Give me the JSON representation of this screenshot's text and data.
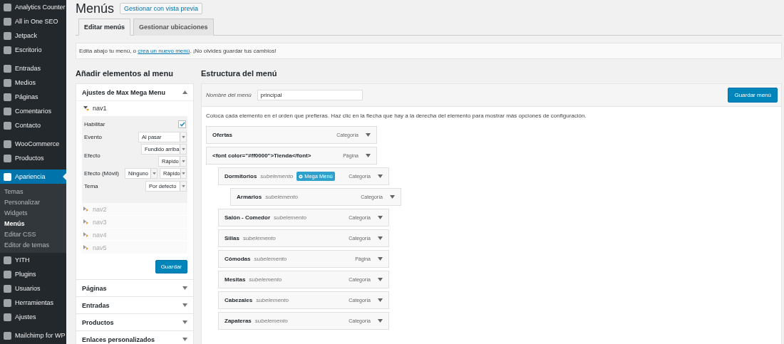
{
  "sidebar": {
    "groups": [
      [
        {
          "label": "Analytics Counter",
          "selected": false
        },
        {
          "label": "All in One SEO",
          "selected": false
        },
        {
          "label": "Jetpack",
          "selected": false
        },
        {
          "label": "Escritorio",
          "selected": false
        }
      ],
      [
        {
          "label": "Entradas",
          "selected": false
        },
        {
          "label": "Medios",
          "selected": false
        },
        {
          "label": "Páginas",
          "selected": false
        },
        {
          "label": "Comentarios",
          "selected": false
        },
        {
          "label": "Contacto",
          "selected": false
        }
      ],
      [
        {
          "label": "WooCommerce",
          "selected": false
        },
        {
          "label": "Productos",
          "selected": false
        }
      ],
      [
        {
          "label": "Apariencia",
          "selected": true,
          "children": [
            {
              "label": "Temas",
              "selected": false
            },
            {
              "label": "Personalizar",
              "selected": false
            },
            {
              "label": "Widgets",
              "selected": false
            },
            {
              "label": "Menús",
              "selected": true
            },
            {
              "label": "Editar CSS",
              "selected": false
            },
            {
              "label": "Editor de temas",
              "selected": false
            }
          ]
        },
        {
          "label": "YITH",
          "selected": false
        },
        {
          "label": "Plugins",
          "selected": false
        },
        {
          "label": "Usuarios",
          "selected": false
        },
        {
          "label": "Herramientas",
          "selected": false
        },
        {
          "label": "Ajustes",
          "selected": false
        }
      ],
      [
        {
          "label": "Mailchimp for WP",
          "selected": false
        }
      ]
    ]
  },
  "page": {
    "title": "Menús",
    "preview_button": "Gestionar con vista previa"
  },
  "tabs": [
    {
      "label": "Editar menús",
      "selected": true
    },
    {
      "label": "Gestionar ubicaciones",
      "selected": false
    }
  ],
  "notice": {
    "before": "Edita abajo tu menú, o ",
    "link": "crea un nuevo menú",
    "after": ". ¡No olvides guardar tus cambios!"
  },
  "add_items": {
    "heading": "Añadir elementos al menu",
    "mega_menu": {
      "title": "Ajustes de Max Mega Menu",
      "expanded": true,
      "save_button": "Guardar",
      "locations": [
        {
          "name": "nav1",
          "expanded": true,
          "settings": [
            {
              "kind": "checkbox",
              "label": "Habilitar",
              "checked": true
            },
            {
              "kind": "select",
              "label": "Evento",
              "values": [
                "Al pasar"
              ]
            },
            {
              "kind": "select",
              "label": "Efecto",
              "values": [
                "Fundido arriba",
                "Rápido"
              ]
            },
            {
              "kind": "selectrow",
              "label": "Efecto (Móvil)",
              "values": [
                "Ninguno",
                "Rápido"
              ]
            },
            {
              "kind": "select",
              "label": "Tema",
              "values": [
                "Por defecto"
              ]
            }
          ]
        },
        {
          "name": "nav2",
          "expanded": false
        },
        {
          "name": "nav3",
          "expanded": false
        },
        {
          "name": "nav4",
          "expanded": false
        },
        {
          "name": "nav5",
          "expanded": false
        }
      ]
    },
    "panels": [
      {
        "title": "Páginas",
        "expanded": false
      },
      {
        "title": "Entradas",
        "expanded": false
      },
      {
        "title": "Productos",
        "expanded": false
      },
      {
        "title": "Enlaces personalizados",
        "expanded": false
      }
    ]
  },
  "structure": {
    "heading": "Estructura del menú",
    "name_label": "Nombre del menú",
    "name_value": "principal",
    "save_button": "Guardar menú",
    "instructions": "Coloca cada elemento en el orden que prefieras. Haz clic en la flecha que hay a la derecha del elemento para mostrar más opciones de configuración.",
    "items": [
      {
        "title": "Ofertas",
        "type": "Categoría"
      },
      {
        "title": "<font color=\"#ff0000\">Tienda</font>",
        "type": "Página",
        "children": [
          {
            "title": "Dormitorios",
            "subtitle": "subelemento",
            "badge": "Mega Menú",
            "type": "Categoría",
            "children": [
              {
                "title": "Armarios",
                "subtitle": "subelemento",
                "type": "Categoría"
              }
            ]
          },
          {
            "title": "Salón - Comedor",
            "subtitle": "subelemento",
            "type": "Categoría"
          },
          {
            "title": "Sillas",
            "subtitle": "subelemento",
            "type": "Categoría"
          },
          {
            "title": "Cómodas",
            "subtitle": "subelemento",
            "type": "Página"
          },
          {
            "title": "Mesitas",
            "subtitle": "subelemento",
            "type": "Categoría"
          },
          {
            "title": "Cabezales",
            "subtitle": "subelemento",
            "type": "Categoría"
          },
          {
            "title": "Zapateras",
            "subtitle": "subelemento",
            "type": "Categoría"
          }
        ]
      }
    ]
  }
}
